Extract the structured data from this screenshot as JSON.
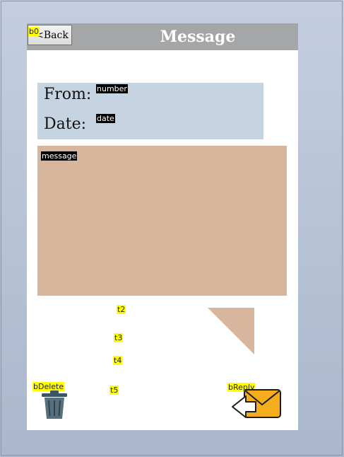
{
  "header": {
    "title": "Message",
    "back_label": "<Back",
    "back_tag": "b0"
  },
  "info": {
    "from_label": "From:",
    "date_label": "Date:",
    "number_placeholder": "number",
    "date_placeholder": "date"
  },
  "message": {
    "placeholder": "message"
  },
  "texts": {
    "t2": "t2",
    "t3": "t3",
    "t4": "t4",
    "t5": "t5"
  },
  "actions": {
    "delete_tag": "bDelete",
    "reply_tag": "bReply"
  },
  "icons": {
    "delete": "trash-can-icon",
    "reply": "envelope-reply-icon"
  },
  "colors": {
    "header_bg": "#a4a6a7",
    "info_bg": "#c6d3e0",
    "message_bg": "#d8b69d",
    "tag_bg": "#ffff00"
  }
}
